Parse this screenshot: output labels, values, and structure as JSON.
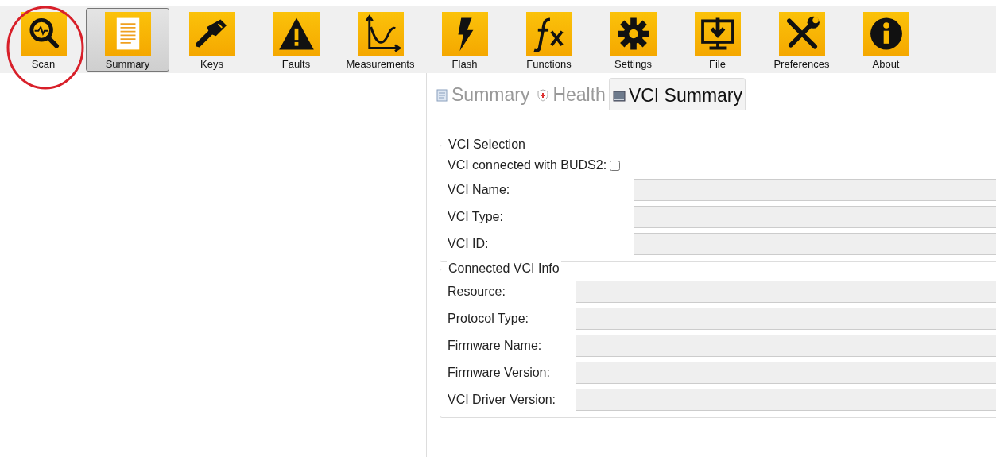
{
  "toolbar": [
    {
      "label": "Scan",
      "selected": false
    },
    {
      "label": "Summary",
      "selected": true
    },
    {
      "label": "Keys",
      "selected": false
    },
    {
      "label": "Faults",
      "selected": false
    },
    {
      "label": "Measurements",
      "selected": false
    },
    {
      "label": "Flash",
      "selected": false
    },
    {
      "label": "Functions",
      "selected": false
    },
    {
      "label": "Settings",
      "selected": false
    },
    {
      "label": "File",
      "selected": false
    },
    {
      "label": "Preferences",
      "selected": false
    },
    {
      "label": "About",
      "selected": false
    }
  ],
  "tabs": [
    {
      "label": "Summary",
      "selected": false
    },
    {
      "label": "Health",
      "selected": false
    },
    {
      "label": "VCI Summary",
      "selected": true
    }
  ],
  "groups": [
    {
      "title": "VCI Selection",
      "checkbox": {
        "label": "VCI connected with BUDS2:",
        "checked": false
      },
      "fields": [
        {
          "label": "VCI Name:"
        },
        {
          "label": "VCI Type:"
        },
        {
          "label": "VCI ID:"
        }
      ]
    },
    {
      "title": "Connected VCI Info",
      "fields": [
        {
          "label": "Resource:"
        },
        {
          "label": "Protocol Type:"
        },
        {
          "label": "Firmware Name:"
        },
        {
          "label": "Firmware Version:"
        },
        {
          "label": "VCI Driver Version:"
        }
      ]
    }
  ]
}
